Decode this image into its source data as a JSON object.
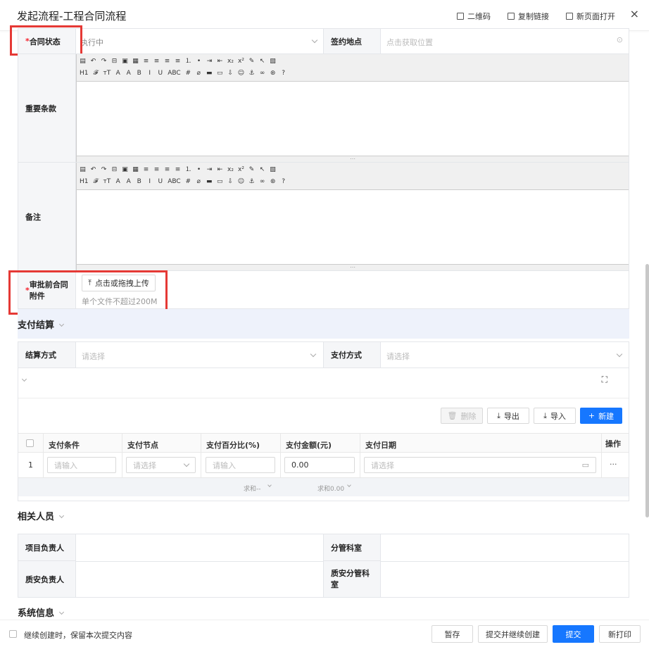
{
  "header": {
    "title": "发起流程-工程合同流程",
    "qrcode": "二维码",
    "copy_link": "复制链接",
    "open_new": "新页面打开",
    "close": "×"
  },
  "fields": {
    "contract_status_label": "合同状态",
    "contract_status_value": "执行中",
    "sign_place_label": "签约地点",
    "sign_place_placeholder": "点击获取位置",
    "key_terms_label": "重要条款",
    "remarks_label": "备注",
    "attachment_label": "审批前合同附件",
    "upload_button": "点击或拖拽上传",
    "upload_hint": "单个文件不超过200M"
  },
  "editor": {
    "row1": [
      "▤",
      "↶",
      "↷",
      "⊟",
      "▣",
      "▦",
      "≡",
      "≡",
      "≡",
      "≡",
      "⒈",
      "•",
      "⇥",
      "⇤",
      "x₂",
      "x²",
      "✎",
      "↖",
      "▧"
    ],
    "row2": [
      "H1",
      "𝓕",
      "тT",
      "A",
      "A",
      "B",
      "I",
      "U",
      "ABC",
      "#",
      "⌀",
      "▬",
      "▭",
      "⇩",
      "☺",
      "⚓",
      "∞",
      "⊛",
      "?"
    ]
  },
  "payment": {
    "section_title": "支付结算",
    "method_label": "结算方式",
    "method_placeholder": "请选择",
    "pay_label": "支付方式",
    "pay_placeholder": "请选择",
    "delete_btn": "删除",
    "export_btn": "导出",
    "import_btn": "导入",
    "new_btn": "新建",
    "columns": [
      "支付条件",
      "支付节点",
      "支付百分比(%)",
      "支付金额(元)",
      "支付日期",
      "操作"
    ],
    "row_index": "1",
    "row_cond_placeholder": "请输入",
    "row_node_placeholder": "请选择",
    "row_pct_placeholder": "请输入",
    "row_amount": "0.00",
    "row_date_placeholder": "请选择",
    "row_more": "···",
    "sum_pct": "求和--",
    "sum_amount": "求和0.00"
  },
  "people": {
    "section_title": "相关人员",
    "project_lead": "项目负责人",
    "dept": "分管科室",
    "safety_lead": "质安负责人",
    "safety_dept": "质安分管科室"
  },
  "system": {
    "section_title": "系统信息"
  },
  "footer": {
    "keep_label": "继续创建时，保留本次提交内容",
    "save": "暂存",
    "submit_continue": "提交并继续创建",
    "submit": "提交",
    "print": "新打印"
  },
  "colors": {
    "primary": "#1677ff",
    "highlight": "#e53935",
    "label_bg": "#f5f6f8"
  }
}
